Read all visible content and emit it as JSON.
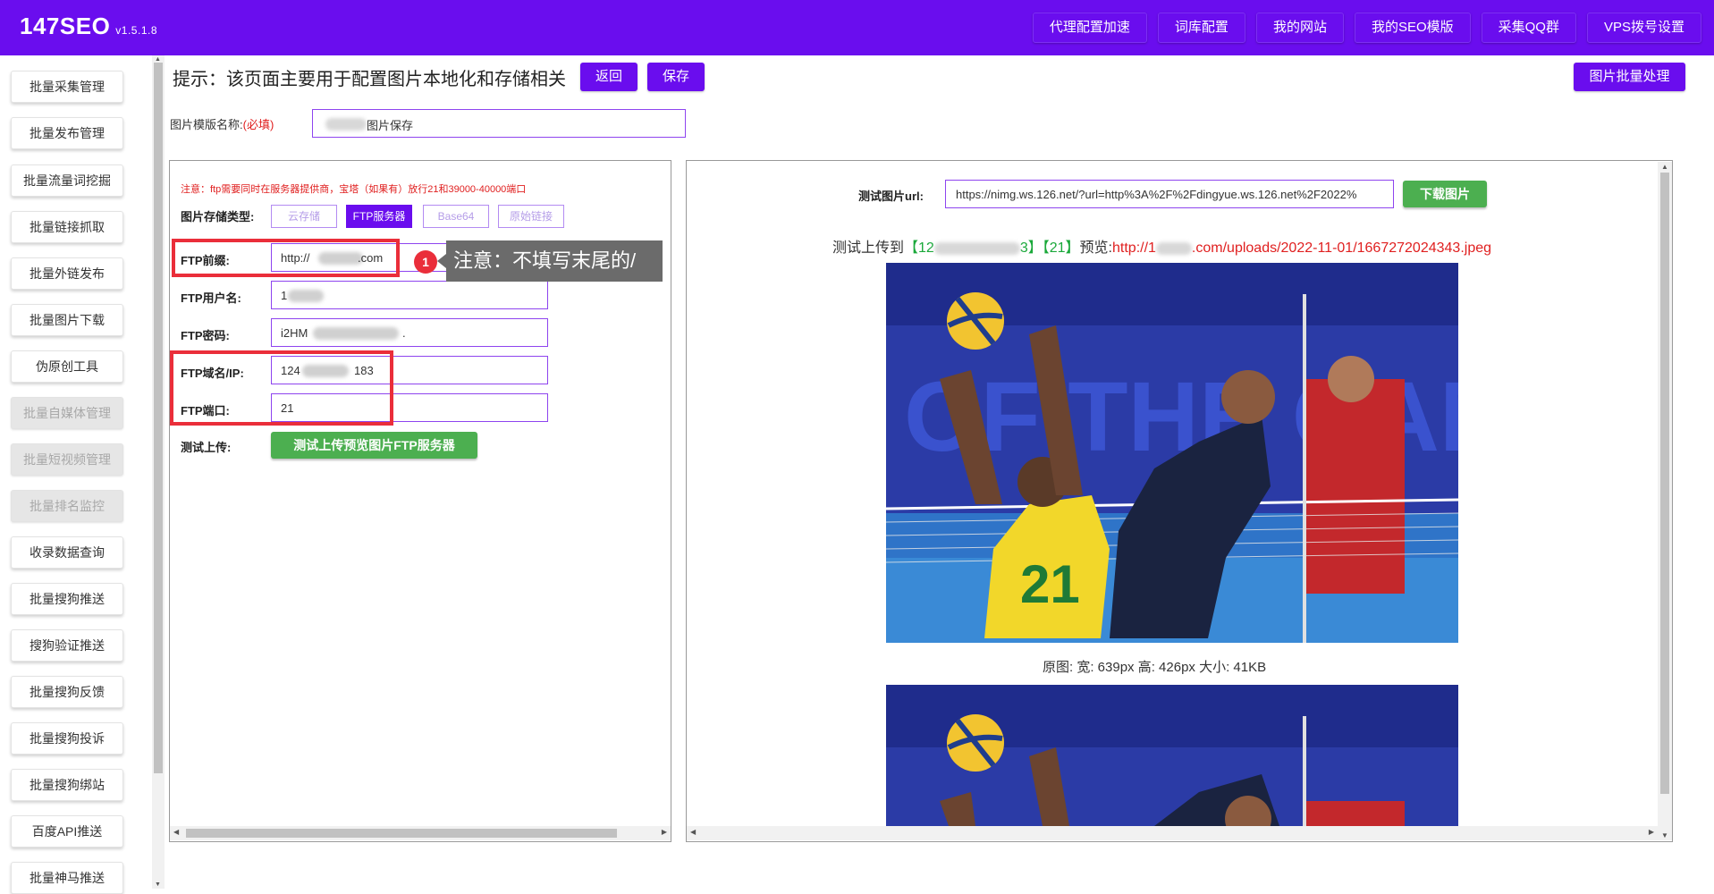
{
  "app": {
    "brand": "147SEO",
    "version": "v1.5.1.8"
  },
  "topnav": [
    "代理配置加速",
    "词库配置",
    "我的网站",
    "我的SEO模版",
    "采集QQ群",
    "VPS拨号设置"
  ],
  "sidebar": {
    "items": [
      {
        "label": "批量采集管理",
        "disabled": false
      },
      {
        "label": "批量发布管理",
        "disabled": false
      },
      {
        "label": "批量流量词挖掘",
        "disabled": false
      },
      {
        "label": "批量链接抓取",
        "disabled": false
      },
      {
        "label": "批量外链发布",
        "disabled": false
      },
      {
        "label": "批量图片下载",
        "disabled": false
      },
      {
        "label": "伪原创工具",
        "disabled": false
      },
      {
        "label": "批量自媒体管理",
        "disabled": true
      },
      {
        "label": "批量短视频管理",
        "disabled": true
      },
      {
        "label": "批量排名监控",
        "disabled": true
      },
      {
        "label": "收录数据查询",
        "disabled": false
      },
      {
        "label": "批量搜狗推送",
        "disabled": false
      },
      {
        "label": "搜狗验证推送",
        "disabled": false
      },
      {
        "label": "批量搜狗反馈",
        "disabled": false
      },
      {
        "label": "批量搜狗投诉",
        "disabled": false
      },
      {
        "label": "批量搜狗绑站",
        "disabled": false
      },
      {
        "label": "百度API推送",
        "disabled": false
      },
      {
        "label": "批量神马推送",
        "disabled": false
      }
    ]
  },
  "page": {
    "tip": "提示：该页面主要用于配置图片本地化和存储相关",
    "back_label": "返回",
    "save_label": "保存",
    "batch_label": "图片批量处理",
    "template_name_label": "图片模版名称:",
    "template_name_required": "(必填)",
    "template_name_value": "图片保存"
  },
  "ftp": {
    "note": "注意：ftp需要同时在服务器提供商，宝塔（如果有）放行21和39000-40000端口",
    "storage_type_label": "图片存储类型:",
    "storage_types": [
      {
        "label": "云存储",
        "active": false
      },
      {
        "label": "FTP服务器",
        "active": true
      },
      {
        "label": "Base64",
        "active": false
      },
      {
        "label": "原始链接",
        "active": false
      }
    ],
    "prefix_label": "FTP前缀:",
    "prefix_value_a": "http://",
    "prefix_value_b": ".com",
    "username_label": "FTP用户名:",
    "username_value": "1",
    "password_label": "FTP密码:",
    "password_value_a": "i2HM",
    "password_value_b": ".",
    "host_label": "FTP域名/IP:",
    "host_value_a": "124",
    "host_value_b": "183",
    "port_label": "FTP端口:",
    "port_value": "21",
    "test_label": "测试上传:",
    "test_button": "测试上传预览图片FTP服务器",
    "callout_number": "1",
    "callout_text": "注意：不填写末尾的/"
  },
  "preview": {
    "url_label": "测试图片url:",
    "url_value": "https://nimg.ws.126.net/?url=http%3A%2F%2Fdingyue.ws.126.net%2F2022%",
    "download_button": "下载图片",
    "result_prefix": "测试上传到",
    "result_host_a": "【12",
    "result_host_b": "3】",
    "result_port": "【21】",
    "result_preview_label": "预览:",
    "result_link_a": "http://1",
    "result_link_b": ".com/uploads/2022-11-01/1667272024343.jpeg",
    "dims_text": "原图: 宽: 639px 高: 426px 大小: 41KB"
  }
}
